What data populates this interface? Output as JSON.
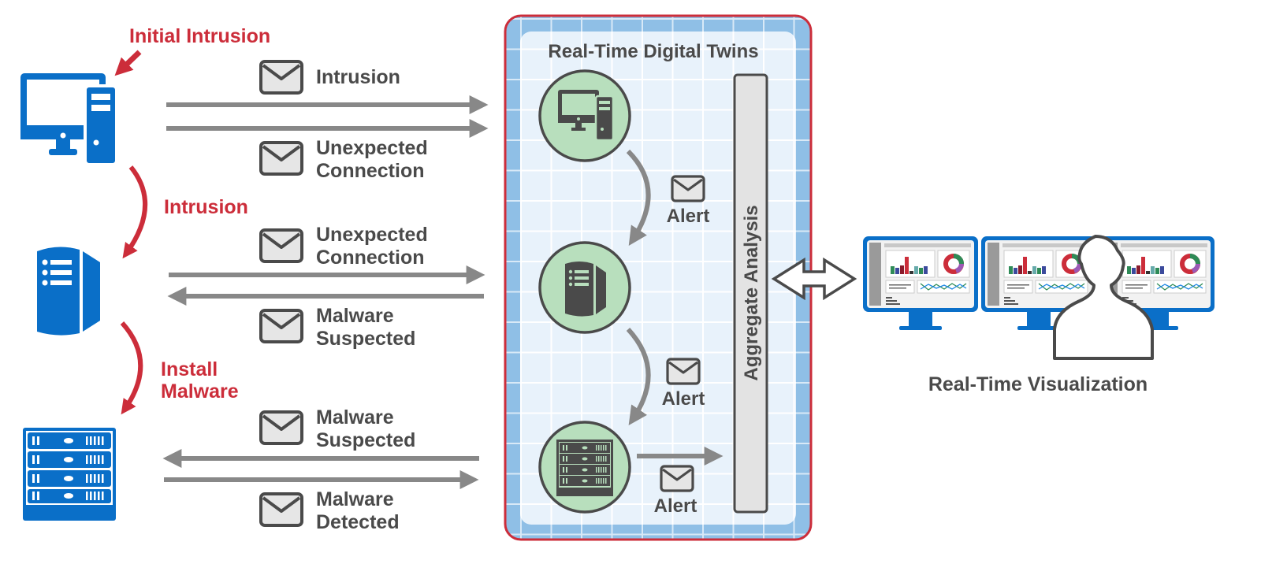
{
  "colors": {
    "accent_red": "#cc2d3a",
    "device_blue": "#0a6fc8",
    "arrow_gray": "#888888",
    "text_dark": "#4a4a4a",
    "twin_green": "#b8dfbd",
    "grid_blue": "#8fbfe6",
    "panel_light": "#e8f2fb",
    "envelope_fill": "#e6e6e6"
  },
  "left_devices": [
    {
      "icon": "desktop-computer-icon",
      "name": "Workstation"
    },
    {
      "icon": "server-tower-icon",
      "name": "Server"
    },
    {
      "icon": "server-rack-icon",
      "name": "Rack Server"
    }
  ],
  "attack_steps": {
    "initial": "Initial Intrusion",
    "step1": "Intrusion",
    "step2_line1": "Install",
    "step2_line2": "Malware"
  },
  "messages": [
    {
      "line1": "Intrusion",
      "line2": "",
      "direction": "right"
    },
    {
      "line1": "Unexpected",
      "line2": "Connection",
      "direction": "right"
    },
    {
      "line1": "Unexpected",
      "line2": "Connection",
      "direction": "right"
    },
    {
      "line1": "Malware",
      "line2": "Suspected",
      "direction": "left"
    },
    {
      "line1": "Malware",
      "line2": "Suspected",
      "direction": "left"
    },
    {
      "line1": "Malware",
      "line2": "Detected",
      "direction": "right"
    }
  ],
  "twins_panel": {
    "title": "Real-Time Digital Twins",
    "alerts": [
      "Alert",
      "Alert",
      "Alert"
    ],
    "aggregate_label": "Aggregate Analysis"
  },
  "visualization": {
    "label": "Real-Time Visualization",
    "monitors": 3
  }
}
